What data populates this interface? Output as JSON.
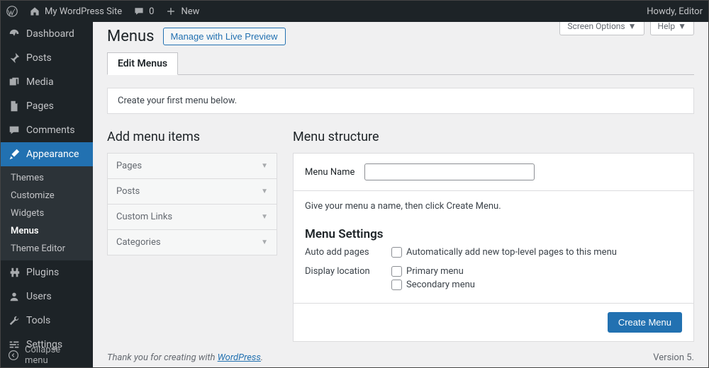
{
  "adminbar": {
    "site_name": "My WordPress Site",
    "comments_count": "0",
    "new_label": "New",
    "greeting": "Howdy, Editor"
  },
  "sidebar": {
    "items": [
      {
        "label": "Dashboard"
      },
      {
        "label": "Posts"
      },
      {
        "label": "Media"
      },
      {
        "label": "Pages"
      },
      {
        "label": "Comments"
      },
      {
        "label": "Appearance"
      },
      {
        "label": "Plugins"
      },
      {
        "label": "Users"
      },
      {
        "label": "Tools"
      },
      {
        "label": "Settings"
      }
    ],
    "appearance_submenu": [
      {
        "label": "Themes"
      },
      {
        "label": "Customize"
      },
      {
        "label": "Widgets"
      },
      {
        "label": "Menus"
      },
      {
        "label": "Theme Editor"
      }
    ],
    "collapse_label": "Collapse menu"
  },
  "header": {
    "title": "Menus",
    "live_preview_btn": "Manage with Live Preview",
    "screen_options_btn": "Screen Options",
    "help_btn": "Help"
  },
  "tabs": {
    "edit": "Edit Menus"
  },
  "notice_first_menu": "Create your first menu below.",
  "add_items": {
    "heading": "Add menu items",
    "panels": [
      "Pages",
      "Posts",
      "Custom Links",
      "Categories"
    ]
  },
  "structure": {
    "heading": "Menu structure",
    "name_label": "Menu Name",
    "name_value": "",
    "hint": "Give your menu a name, then click Create Menu.",
    "settings_heading": "Menu Settings",
    "auto_add_label": "Auto add pages",
    "auto_add_option": "Automatically add new top-level pages to this menu",
    "display_loc_label": "Display location",
    "display_loc_options": [
      "Primary menu",
      "Secondary menu"
    ],
    "create_btn": "Create Menu"
  },
  "footer": {
    "thankyou_prefix": "Thank you for creating with ",
    "thankyou_link": "WordPress",
    "thankyou_suffix": ".",
    "version": "Version 5."
  }
}
